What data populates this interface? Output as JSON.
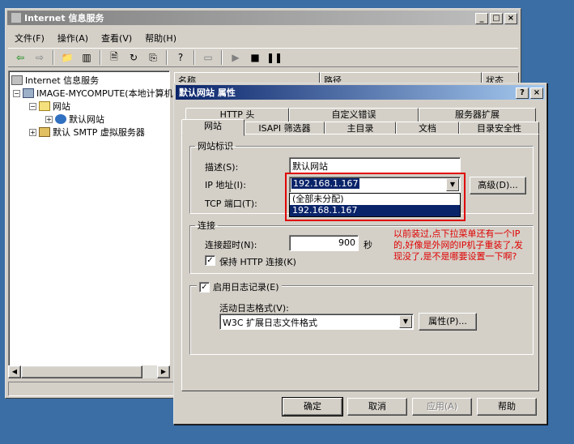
{
  "main_window": {
    "title": "Internet 信息服务",
    "controls": {
      "minimize": "_",
      "maximize": "□",
      "close": "×"
    },
    "menu": [
      "文件(F)",
      "操作(A)",
      "查看(V)",
      "帮助(H)"
    ],
    "tree": {
      "root": "Internet 信息服务",
      "computer": "IMAGE-MYCOMPUTE(本地计算机",
      "sites_folder": "网站",
      "default_site": "默认网站",
      "smtp": "默认 SMTP 虚拟服务器"
    },
    "list_columns": [
      "名称",
      "路径",
      "状态"
    ]
  },
  "dialog": {
    "title": "默认网站 属性",
    "help_btn": "?",
    "close_btn": "×",
    "tabs_row1": [
      "HTTP 头",
      "自定义错误",
      "服务器扩展"
    ],
    "tabs_row2": [
      "网站",
      "ISAPI 筛选器",
      "主目录",
      "文档",
      "目录安全性"
    ],
    "identity_group": "网站标识",
    "desc_label": "描述(S):",
    "desc_value": "默认网站",
    "ip_label": "IP 地址(I):",
    "ip_value": "192.168.1.167",
    "ip_options": [
      "(全部未分配)",
      "192.168.1.167"
    ],
    "advanced_btn": "高级(D)...",
    "tcp_label": "TCP 端口(T):",
    "connection_group": "连接",
    "timeout_label": "连接超时(N):",
    "timeout_value": "900",
    "timeout_unit": "秒",
    "keepalive_label": "保持 HTTP 连接(K)",
    "keepalive_checked": true,
    "logging_label": "启用日志记录(E)",
    "logging_checked": true,
    "log_format_label": "活动日志格式(V):",
    "log_format_value": "W3C 扩展日志文件格式",
    "properties_btn": "属性(P)...",
    "ok_btn": "确定",
    "cancel_btn": "取消",
    "apply_btn": "应用(A)",
    "help_bottom_btn": "帮助"
  },
  "annotation": "以前装过,点下拉菜单还有一个IP的,好像是外网的IP机子重装了,发现没了,是不是哪要设置一下啊?",
  "colors": {
    "desktop": "#3a6ea5",
    "highlight": "#0a246a",
    "annotation": "#e00000",
    "callout_border": "#e00000"
  }
}
